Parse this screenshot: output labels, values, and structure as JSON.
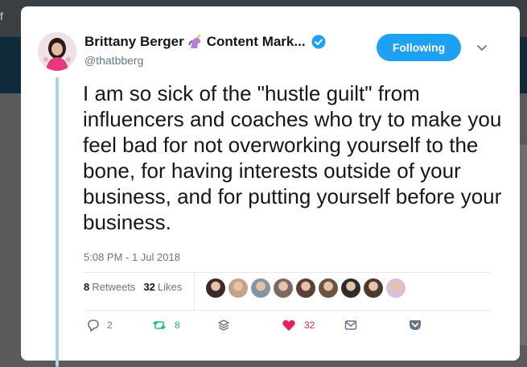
{
  "background": {
    "topbar_text": "f"
  },
  "tweet": {
    "display_name": "Brittany Berger",
    "name_suffix": "Content Mark...",
    "name_emoji": "unicorn-icon",
    "handle": "@thatbberg",
    "follow_label": "Following",
    "text": "I am so sick of the \"hustle guilt\" from influencers and coaches who try to make you feel bad for not overworking yourself to the bone, for having interests outside of your business, and for putting yourself before your business.",
    "timestamp": "5:08 PM - 1 Jul 2018",
    "retweets_count": "8",
    "retweets_label": "Retweets",
    "likes_count": "32",
    "likes_label": "Likes",
    "liker_avatars": [
      "#3b2a25",
      "#c7a08a",
      "#8893a0",
      "#7a6a62",
      "#5a4038",
      "#6b5540",
      "#2d2d2d",
      "#4a3a30",
      "#d9c0d6"
    ],
    "actions": {
      "reply_count": "2",
      "retweet_count": "8",
      "like_count": "32"
    }
  },
  "colors": {
    "accent": "#1da1f2",
    "retweet_green": "#17bf63",
    "like_red": "#e0245e",
    "thread_line": "#a6d4f2"
  }
}
